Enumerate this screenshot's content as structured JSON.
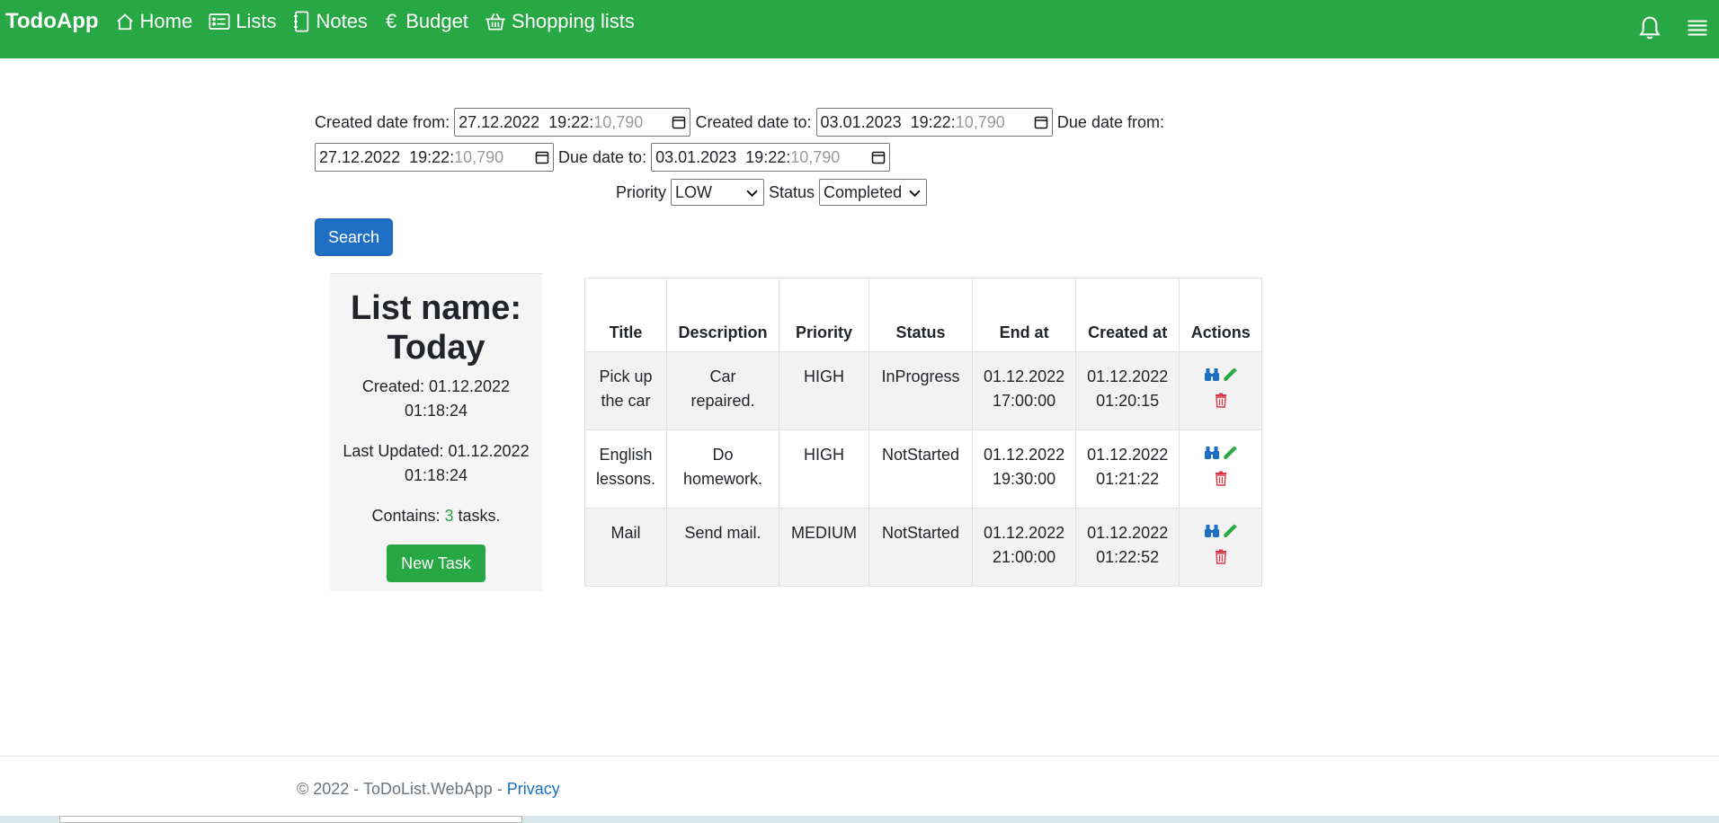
{
  "nav": {
    "brand": "TodoApp",
    "links": [
      {
        "label": "Home",
        "icon": "house-icon"
      },
      {
        "label": "Lists",
        "icon": "card-list-icon"
      },
      {
        "label": "Notes",
        "icon": "journal-icon"
      },
      {
        "label": "Budget",
        "icon": "euro-icon"
      },
      {
        "label": "Shopping lists",
        "icon": "basket-icon"
      }
    ],
    "euro_symbol": "€"
  },
  "filters": {
    "created_from_label": "Created date from:",
    "created_from_value": "27.12.2022  19:22:",
    "created_from_ghost": "10,790",
    "created_to_label": "Created date to:",
    "created_to_value": "03.01.2023  19:22:",
    "created_to_ghost": "10,790",
    "due_from_label": "Due date from:",
    "due_from_value": "27.12.2022  19:22:",
    "due_from_ghost": "10,790",
    "due_to_label": "Due date to:",
    "due_to_value": "03.01.2023  19:22:",
    "due_to_ghost": "10,790",
    "priority_label": "Priority",
    "priority_value": "LOW",
    "status_label": "Status",
    "status_value": "Completed",
    "search_label": "Search"
  },
  "list": {
    "title": "List name: Today",
    "created": "Created: 01.12.2022 01:18:24",
    "updated": "Last Updated: 01.12.2022 01:18:24",
    "contains_prefix": "Contains: ",
    "task_count": "3",
    "contains_suffix": " tasks.",
    "new_task_label": "New Task"
  },
  "table": {
    "headers": [
      "Title",
      "Description",
      "Priority",
      "Status",
      "End at",
      "Created at",
      "Actions"
    ],
    "rows": [
      {
        "title": "Pick up the car",
        "description": "Car repaired.",
        "priority": "HIGH",
        "status": "InProgress",
        "end_at": "01.12.2022 17:00:00",
        "created_at": "01.12.2022 01:20:15"
      },
      {
        "title": "English lessons.",
        "description": "Do homework.",
        "priority": "HIGH",
        "status": "NotStarted",
        "end_at": "01.12.2022 19:30:00",
        "created_at": "01.12.2022 01:21:22"
      },
      {
        "title": "Mail",
        "description": "Send mail.",
        "priority": "MEDIUM",
        "status": "NotStarted",
        "end_at": "01.12.2022 21:00:00",
        "created_at": "01.12.2022 01:22:52"
      }
    ]
  },
  "footer": {
    "text": "© 2022 - ToDoList.WebApp - ",
    "privacy": "Privacy"
  },
  "colors": {
    "navbar": "#28a745",
    "primary": "#1f6fc5",
    "view_icon": "#1b6ec2",
    "edit_icon": "#28a745",
    "delete_icon": "#dc3545"
  }
}
